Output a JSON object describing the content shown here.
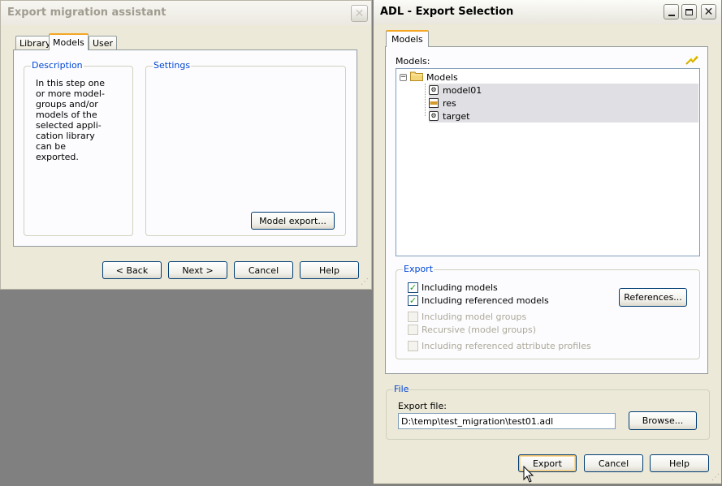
{
  "left_window": {
    "title": "Export migration assistant",
    "tabs": [
      {
        "label": "Library"
      },
      {
        "label": "Models"
      },
      {
        "label": "User"
      }
    ],
    "description_group": {
      "legend": "Description",
      "lines": [
        "In this step one",
        "or more model-",
        "groups and/or",
        "models of the",
        "selected appli-",
        "cation library",
        "can be",
        "exported."
      ]
    },
    "settings_group": {
      "legend": "Settings",
      "model_export_button": "Model export..."
    },
    "buttons": {
      "back": "< Back",
      "next": "Next >",
      "cancel": "Cancel",
      "help": "Help"
    }
  },
  "right_window": {
    "title": "ADL - Export Selection",
    "tab": "Models",
    "models_label": "Models:",
    "tree": {
      "root": "Models",
      "children": [
        "model01",
        "res",
        "target"
      ]
    },
    "export_group": {
      "legend": "Export",
      "checkboxes": [
        {
          "label": "Including models",
          "checked": true,
          "enabled": true
        },
        {
          "label": "Including referenced models",
          "checked": true,
          "enabled": true
        },
        {
          "label": "Including model groups",
          "checked": false,
          "enabled": false
        },
        {
          "label": "Recursive (model groups)",
          "checked": false,
          "enabled": false
        },
        {
          "label": "Including referenced attribute profiles",
          "checked": false,
          "enabled": false
        }
      ],
      "references_button": "References..."
    },
    "file_group": {
      "legend": "File",
      "export_file_label": "Export file:",
      "export_file_value": "D:\\temp\\test_migration\\test01.adl",
      "browse_button": "Browse..."
    },
    "buttons": {
      "export": "Export",
      "cancel": "Cancel",
      "help": "Help"
    }
  },
  "colors": {
    "accent_legend": "#0046d5",
    "tab_highlight": "#f5a623",
    "check_green": "#21a121"
  }
}
